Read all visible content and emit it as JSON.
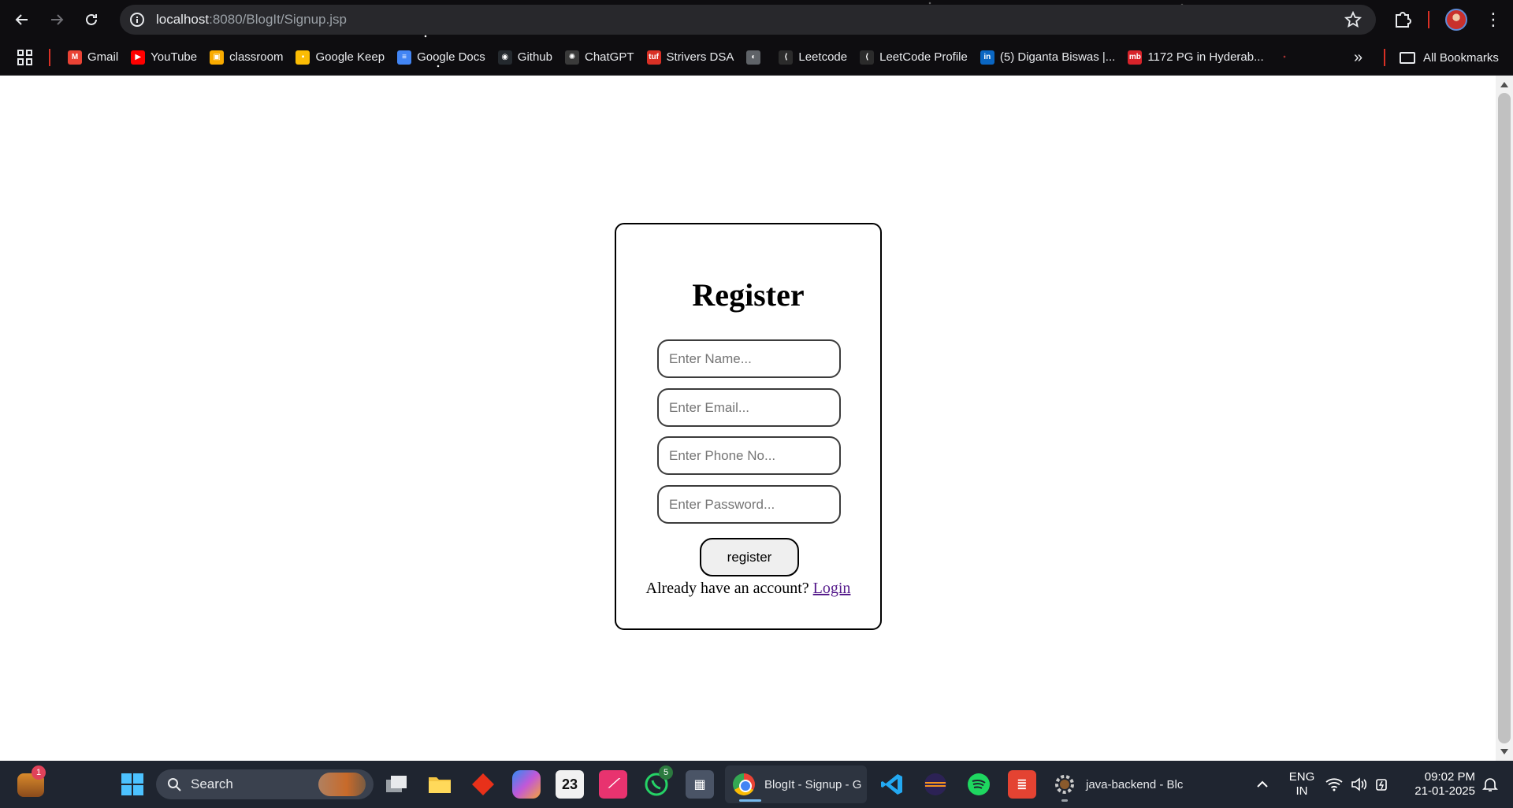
{
  "browser": {
    "url_host": "localhost",
    "url_rest": ":8080/BlogIt/Signup.jsp"
  },
  "bookmarks": {
    "items": [
      {
        "label": "Gmail",
        "icon": "gmail-icon",
        "color": "#ea4335",
        "glyph": "M"
      },
      {
        "label": "YouTube",
        "icon": "youtube-icon",
        "color": "#ff0000",
        "glyph": "▶"
      },
      {
        "label": "classroom",
        "icon": "classroom-icon",
        "color": "#f9ab00",
        "glyph": "▣"
      },
      {
        "label": "Google Keep",
        "icon": "keep-icon",
        "color": "#fbbc04",
        "glyph": "▪"
      },
      {
        "label": "Google Docs",
        "icon": "docs-icon",
        "color": "#4285f4",
        "glyph": "≡"
      },
      {
        "label": "Github",
        "icon": "github-icon",
        "color": "#24292e",
        "glyph": "◉"
      },
      {
        "label": "ChatGPT",
        "icon": "chatgpt-icon",
        "color": "#3a3a3a",
        "glyph": "✺"
      },
      {
        "label": "Strivers DSA",
        "icon": "tuf-icon",
        "color": "#d93025",
        "glyph": "tuf"
      },
      {
        "label": "",
        "icon": "globe-icon",
        "color": "#5f6368",
        "glyph": "◐"
      },
      {
        "label": "Leetcode",
        "icon": "leetcode-icon",
        "color": "#2b2b2b",
        "glyph": "⟨"
      },
      {
        "label": "LeetCode Profile",
        "icon": "leetcode-icon",
        "color": "#2b2b2b",
        "glyph": "⟨"
      },
      {
        "label": "(5) Diganta Biswas |...",
        "icon": "linkedin-icon",
        "color": "#0a66c2",
        "glyph": "in"
      },
      {
        "label": "1172 PG in Hyderab...",
        "icon": "magicbricks-icon",
        "color": "#d8232a",
        "glyph": "mb"
      }
    ],
    "more": "»",
    "all_bookmarks": "All Bookmarks"
  },
  "form": {
    "title": "Register",
    "name_placeholder": "Enter Name...",
    "email_placeholder": "Enter Email...",
    "phone_placeholder": "Enter Phone No...",
    "password_placeholder": "Enter Password...",
    "submit_label": "register",
    "already_text": "Already have an account?",
    "login_link": "Login"
  },
  "taskbar": {
    "search_label": "Search",
    "weather_badge": "1",
    "whatsapp_badge": "5",
    "calendar_day": "23",
    "chrome_task_label": "BlogIt - Signup - G",
    "eclipse_task_label": "java-backend - Blc",
    "language_line1": "ENG",
    "language_line2": "IN",
    "time": "09:02 PM",
    "date": "21-01-2025"
  }
}
